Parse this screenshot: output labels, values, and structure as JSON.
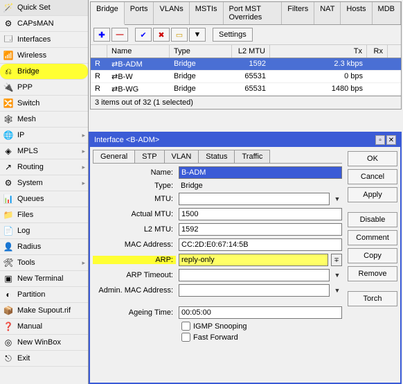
{
  "sidebar": {
    "items": [
      {
        "label": "Quick Set",
        "icon": "🪄"
      },
      {
        "label": "CAPsMAN",
        "icon": "⚙"
      },
      {
        "label": "Interfaces",
        "icon": "🗔"
      },
      {
        "label": "Wireless",
        "icon": "📶"
      },
      {
        "label": "Bridge",
        "icon": "⎌",
        "highlighted": true
      },
      {
        "label": "PPP",
        "icon": "🔌"
      },
      {
        "label": "Switch",
        "icon": "🔀"
      },
      {
        "label": "Mesh",
        "icon": "🕸"
      },
      {
        "label": "IP",
        "icon": "🌐",
        "submenu": true
      },
      {
        "label": "MPLS",
        "icon": "◈",
        "submenu": true
      },
      {
        "label": "Routing",
        "icon": "↗",
        "submenu": true
      },
      {
        "label": "System",
        "icon": "⚙",
        "submenu": true
      },
      {
        "label": "Queues",
        "icon": "📊"
      },
      {
        "label": "Files",
        "icon": "📁"
      },
      {
        "label": "Log",
        "icon": "📄"
      },
      {
        "label": "Radius",
        "icon": "👤"
      },
      {
        "label": "Tools",
        "icon": "🛠",
        "submenu": true
      },
      {
        "label": "New Terminal",
        "icon": "▣"
      },
      {
        "label": "Partition",
        "icon": "◐"
      },
      {
        "label": "Make Supout.rif",
        "icon": "📦"
      },
      {
        "label": "Manual",
        "icon": "❓"
      },
      {
        "label": "New WinBox",
        "icon": "◎"
      },
      {
        "label": "Exit",
        "icon": "⎋"
      }
    ]
  },
  "bridge_panel": {
    "title": "Bridge",
    "tabs": [
      "Bridge",
      "Ports",
      "VLANs",
      "MSTIs",
      "Port MST Overrides",
      "Filters",
      "NAT",
      "Hosts",
      "MDB"
    ],
    "active_tab": "Bridge",
    "settings_label": "Settings",
    "columns": [
      "",
      "Name",
      "Type",
      "L2 MTU",
      "Tx",
      "Rx"
    ],
    "rows": [
      {
        "flag": "R",
        "name": "⇄B-ADM",
        "type": "Bridge",
        "l2mtu": "1592",
        "tx": "2.3 kbps",
        "selected": true
      },
      {
        "flag": "R",
        "name": "⇄B-W",
        "type": "Bridge",
        "l2mtu": "65531",
        "tx": "0 bps"
      },
      {
        "flag": "R",
        "name": "⇄B-WG",
        "type": "Bridge",
        "l2mtu": "65531",
        "tx": "1480 bps"
      }
    ],
    "status": "3 items out of 32 (1 selected)"
  },
  "dialog": {
    "title": "Interface <B-ADM>",
    "tabs": [
      "General",
      "STP",
      "VLAN",
      "Status",
      "Traffic"
    ],
    "active_tab": "General",
    "fields": {
      "name_label": "Name:",
      "name_value": "B-ADM",
      "type_label": "Type:",
      "type_value": "Bridge",
      "mtu_label": "MTU:",
      "mtu_value": "",
      "actual_mtu_label": "Actual MTU:",
      "actual_mtu_value": "1500",
      "l2mtu_label": "L2 MTU:",
      "l2mtu_value": "1592",
      "mac_label": "MAC Address:",
      "mac_value": "CC:2D:E0:67:14:5B",
      "arp_label": "ARP:",
      "arp_value": "reply-only",
      "arp_timeout_label": "ARP Timeout:",
      "arp_timeout_value": "",
      "admin_mac_label": "Admin. MAC Address:",
      "admin_mac_value": "",
      "ageing_label": "Ageing Time:",
      "ageing_value": "00:05:00",
      "igmp_label": "IGMP Snooping",
      "fast_fwd_label": "Fast Forward"
    },
    "buttons": {
      "ok": "OK",
      "cancel": "Cancel",
      "apply": "Apply",
      "disable": "Disable",
      "comment": "Comment",
      "copy": "Copy",
      "remove": "Remove",
      "torch": "Torch"
    }
  }
}
